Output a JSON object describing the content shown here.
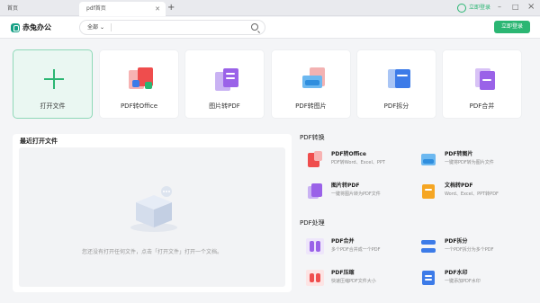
{
  "tabs": {
    "home": "首页",
    "active": "pdf首页",
    "new_tab": "+"
  },
  "top_login": "立即登录",
  "window": {
    "min": "–",
    "max": "□",
    "close": "×"
  },
  "app": {
    "name": "赤兔办公"
  },
  "search": {
    "scope": "全部",
    "placeholder": ""
  },
  "login_button": "立即登录",
  "cards": [
    {
      "label": "打开文件"
    },
    {
      "label": "PDF转Office"
    },
    {
      "label": "图片转PDF"
    },
    {
      "label": "PDF转图片"
    },
    {
      "label": "PDF拆分"
    },
    {
      "label": "PDF合并"
    }
  ],
  "recent": {
    "title": "最近打开文件",
    "empty": "您还没有打开任何文件，点击「打开文件」打开一个文档。"
  },
  "sections": {
    "convert": {
      "title": "PDF转换",
      "items": [
        {
          "title": "PDF转Office",
          "desc": "PDF转Word、Excel、PPT"
        },
        {
          "title": "PDF转图片",
          "desc": "一键将PDF转为图片文件"
        },
        {
          "title": "图片转PDF",
          "desc": "一键将图片转为PDF文件"
        },
        {
          "title": "文档转PDF",
          "desc": "Word、Excel、PPT转PDF"
        }
      ]
    },
    "process": {
      "title": "PDF处理",
      "items": [
        {
          "title": "PDF合并",
          "desc": "多个PDF合并成一个PDF"
        },
        {
          "title": "PDF拆分",
          "desc": "一个PDF拆分为多个PDF"
        },
        {
          "title": "PDF压缩",
          "desc": "快速压缩PDF文件大小"
        },
        {
          "title": "PDF水印",
          "desc": "一键添加PDF水印"
        }
      ]
    }
  },
  "colors": {
    "brand": "#2bb673",
    "red": "#ef4d4d",
    "purple": "#9a62e8",
    "blue": "#3c7be8",
    "orange": "#f5a623"
  }
}
